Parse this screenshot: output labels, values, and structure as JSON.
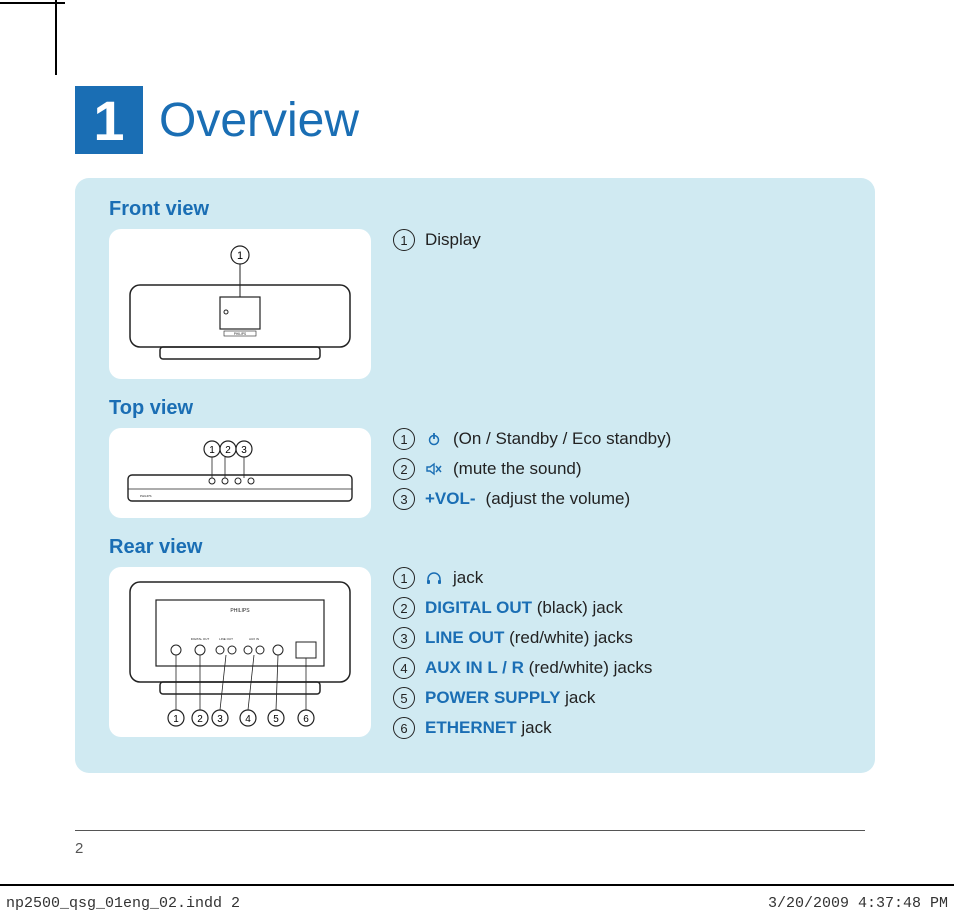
{
  "chapter": {
    "number": "1",
    "title": "Overview"
  },
  "sections": {
    "front": {
      "title": "Front view",
      "items": [
        {
          "num": "1",
          "text": "Display"
        }
      ],
      "callouts": [
        "1"
      ]
    },
    "top": {
      "title": "Top view",
      "items": [
        {
          "num": "1",
          "icon": "power",
          "text": "(On / Standby / Eco standby)"
        },
        {
          "num": "2",
          "icon": "mute",
          "text": " (mute the sound)"
        },
        {
          "num": "3",
          "keyword": "+VOL-",
          "text": " (adjust the volume)"
        }
      ],
      "callouts": [
        "1",
        "2",
        "3"
      ]
    },
    "rear": {
      "title": "Rear view",
      "items": [
        {
          "num": "1",
          "icon": "headphones",
          "text": " jack"
        },
        {
          "num": "2",
          "keyword": "DIGITAL OUT",
          "text": " (black) jack"
        },
        {
          "num": "3",
          "keyword": "LINE OUT",
          "text": " (red/white) jacks"
        },
        {
          "num": "4",
          "keyword": "AUX IN L / R",
          "text": " (red/white) jacks"
        },
        {
          "num": "5",
          "keyword": "POWER SUPPLY",
          "text": " jack"
        },
        {
          "num": "6",
          "keyword": "ETHERNET",
          "text": " jack"
        }
      ],
      "callouts": [
        "1",
        "2",
        "3",
        "4",
        "5",
        "6"
      ],
      "brand": "PHILIPS",
      "rear_jack_labels": [
        "DIGITAL OUT",
        "LINE OUT L R",
        "AUX IN L R"
      ]
    }
  },
  "footer": {
    "page_number": "2",
    "file": "np2500_qsg_01eng_02.indd   2",
    "timestamp": "3/20/2009   4:37:48 PM"
  },
  "brand": "PHILIPS"
}
